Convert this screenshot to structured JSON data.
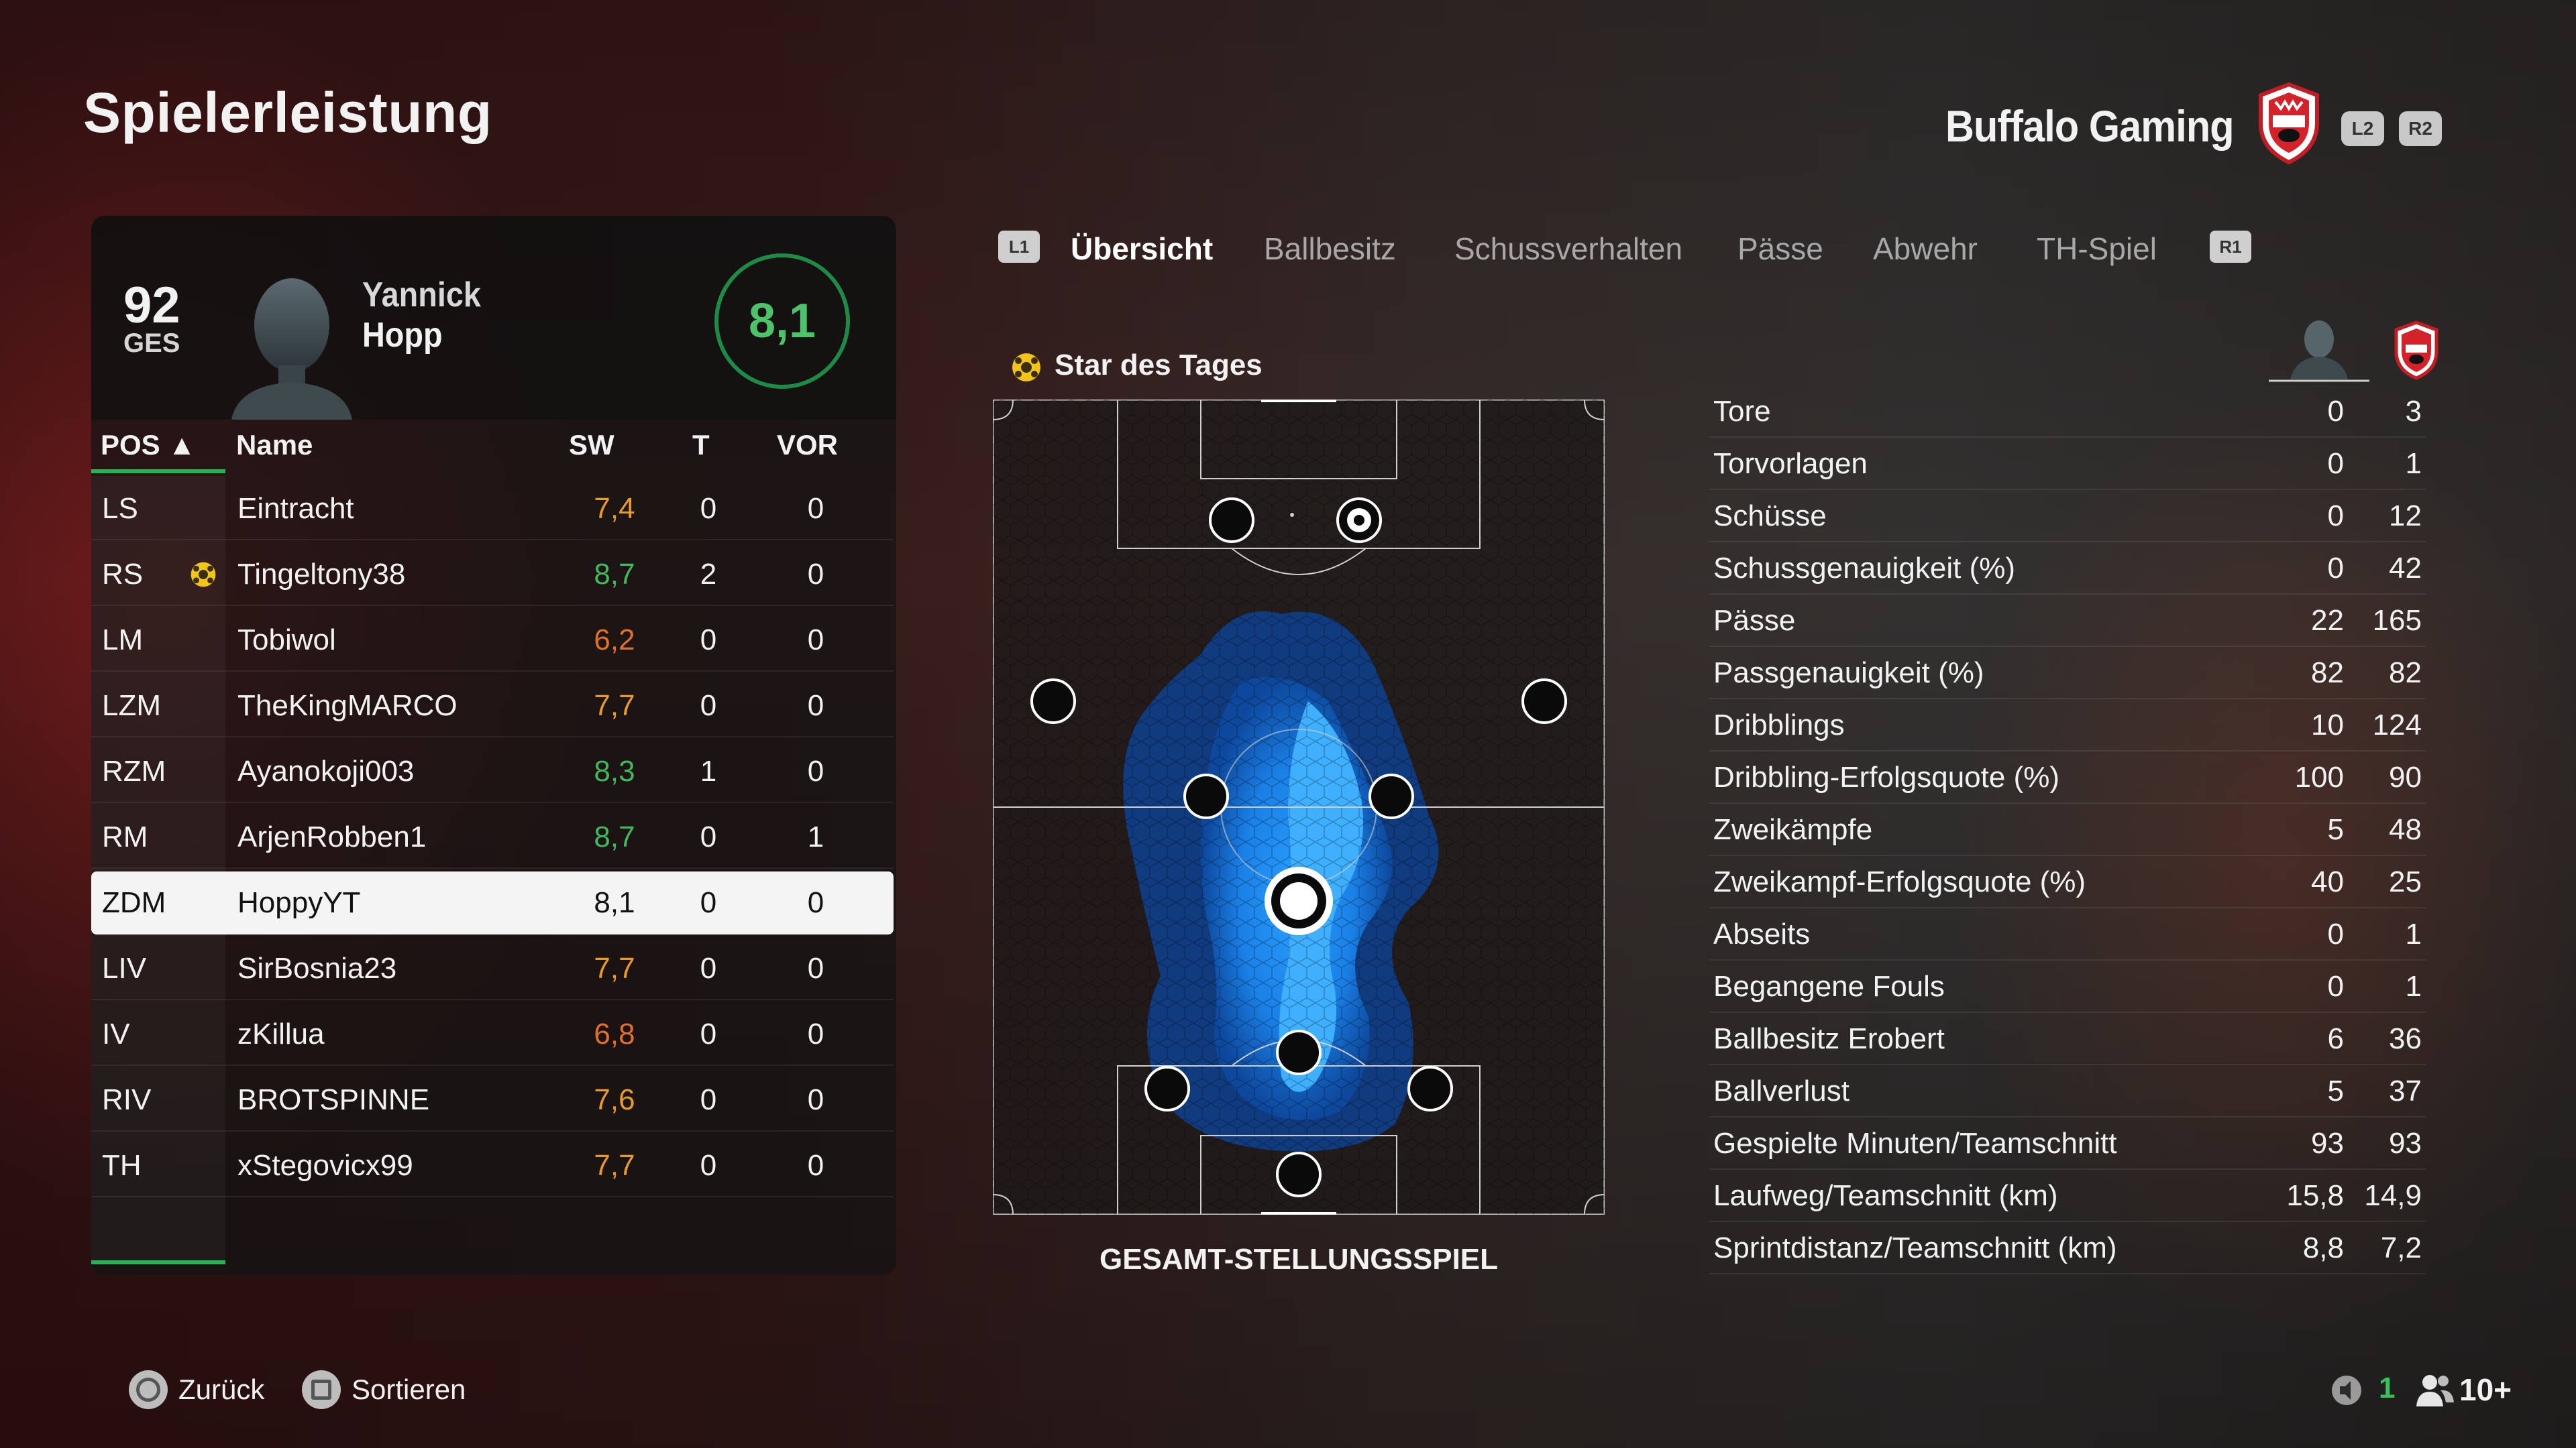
{
  "header": {
    "title": "Spielerleistung",
    "team_name": "Buffalo Gaming",
    "l2_label": "L2",
    "r2_label": "R2"
  },
  "player": {
    "overall": "92",
    "overall_label": "GES",
    "first_name": "Yannick",
    "last_name": "Hopp",
    "rating": "8,1"
  },
  "table": {
    "headers": {
      "pos": "POS ▲",
      "name": "Name",
      "sw": "SW",
      "t": "T",
      "vor": "VOR"
    },
    "rows": [
      {
        "pos": "LS",
        "name": "Eintracht",
        "sw": "7,4",
        "t": "0",
        "vor": "0",
        "sw_color": "#e89a2a",
        "star": false,
        "selected": false
      },
      {
        "pos": "RS",
        "name": "Tingeltony38",
        "sw": "8,7",
        "t": "2",
        "vor": "0",
        "sw_color": "#43b85b",
        "star": true,
        "selected": false
      },
      {
        "pos": "LM",
        "name": "Tobiwol",
        "sw": "6,2",
        "t": "0",
        "vor": "0",
        "sw_color": "#e0702a",
        "star": false,
        "selected": false
      },
      {
        "pos": "LZM",
        "name": "TheKingMARCO",
        "sw": "7,7",
        "t": "0",
        "vor": "0",
        "sw_color": "#e89a2a",
        "star": false,
        "selected": false
      },
      {
        "pos": "RZM",
        "name": "Ayanokoji003",
        "sw": "8,3",
        "t": "1",
        "vor": "0",
        "sw_color": "#43b85b",
        "star": false,
        "selected": false
      },
      {
        "pos": "RM",
        "name": "ArjenRobben1",
        "sw": "8,7",
        "t": "0",
        "vor": "1",
        "sw_color": "#43b85b",
        "star": false,
        "selected": false
      },
      {
        "pos": "ZDM",
        "name": "HoppyYT",
        "sw": "8,1",
        "t": "0",
        "vor": "0",
        "sw_color": "#111111",
        "star": false,
        "selected": true
      },
      {
        "pos": "LIV",
        "name": "SirBosnia23",
        "sw": "7,7",
        "t": "0",
        "vor": "0",
        "sw_color": "#e89a2a",
        "star": false,
        "selected": false
      },
      {
        "pos": "IV",
        "name": "zKillua",
        "sw": "6,8",
        "t": "0",
        "vor": "0",
        "sw_color": "#e0702a",
        "star": false,
        "selected": false
      },
      {
        "pos": "RIV",
        "name": "BROTSPINNE",
        "sw": "7,6",
        "t": "0",
        "vor": "0",
        "sw_color": "#e89a2a",
        "star": false,
        "selected": false
      },
      {
        "pos": "TH",
        "name": "xStegovicx99",
        "sw": "7,7",
        "t": "0",
        "vor": "0",
        "sw_color": "#e89a2a",
        "star": false,
        "selected": false
      }
    ]
  },
  "tabs": {
    "l1_label": "L1",
    "r1_label": "R1",
    "items": [
      "Übersicht",
      "Ballbesitz",
      "Schussverhalten",
      "Pässe",
      "Abwehr",
      "TH-Spiel"
    ],
    "active_index": 0
  },
  "pitch": {
    "star_label": "Star des Tages",
    "caption": "GESAMT-STELLUNGSSPIEL"
  },
  "stats": [
    {
      "label": "Tore",
      "player": "0",
      "team": "3"
    },
    {
      "label": "Torvorlagen",
      "player": "0",
      "team": "1"
    },
    {
      "label": "Schüsse",
      "player": "0",
      "team": "12"
    },
    {
      "label": "Schussgenauigkeit (%)",
      "player": "0",
      "team": "42"
    },
    {
      "label": "Pässe",
      "player": "22",
      "team": "165"
    },
    {
      "label": "Passgenauigkeit (%)",
      "player": "82",
      "team": "82"
    },
    {
      "label": "Dribblings",
      "player": "10",
      "team": "124"
    },
    {
      "label": "Dribbling-Erfolgsquote (%)",
      "player": "100",
      "team": "90"
    },
    {
      "label": "Zweikämpfe",
      "player": "5",
      "team": "48"
    },
    {
      "label": "Zweikampf-Erfolgsquote (%)",
      "player": "40",
      "team": "25"
    },
    {
      "label": "Abseits",
      "player": "0",
      "team": "1"
    },
    {
      "label": "Begangene Fouls",
      "player": "0",
      "team": "1"
    },
    {
      "label": "Ballbesitz Erobert",
      "player": "6",
      "team": "36"
    },
    {
      "label": "Ballverlust",
      "player": "5",
      "team": "37"
    },
    {
      "label": "Gespielte Minuten/Teamschnitt",
      "player": "93",
      "team": "93"
    },
    {
      "label": "Laufweg/Teamschnitt (km)",
      "player": "15,8",
      "team": "14,9"
    },
    {
      "label": "Sprintdistanz/Teamschnitt (km)",
      "player": "8,8",
      "team": "7,2"
    }
  ],
  "footer": {
    "back_label": "Zurück",
    "sort_label": "Sortieren",
    "mic_count": "1",
    "party_count": "10+"
  },
  "colors": {
    "accent_green": "#27b25a",
    "rating_green": "#4cc26a",
    "heatmap_blue": "#1e90ff"
  }
}
